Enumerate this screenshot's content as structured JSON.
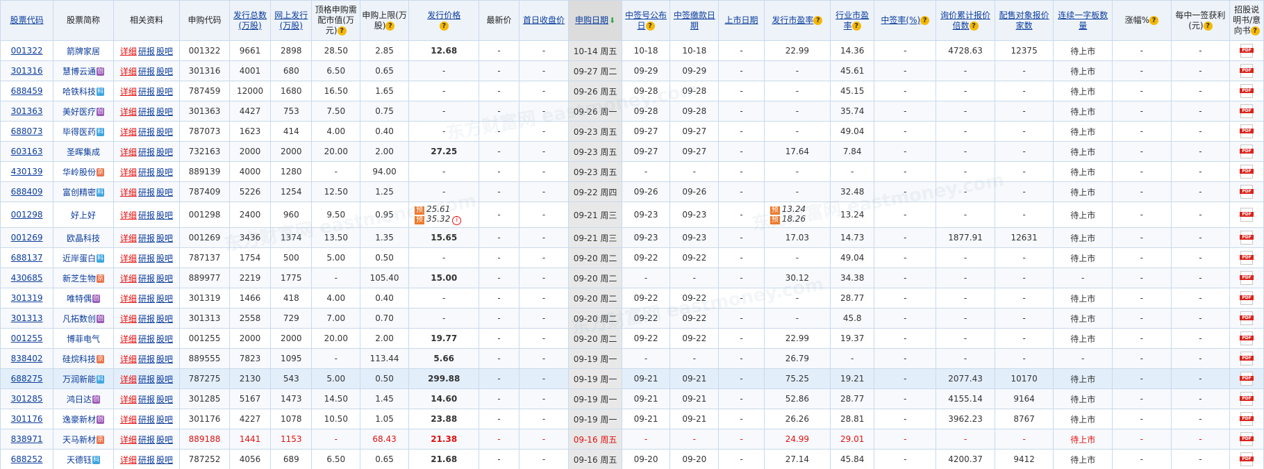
{
  "header": {
    "code": "股票代码",
    "name": "股票简称",
    "related": "相关资料",
    "apply_code": "申购代码",
    "total_issue": "发行总数(万股)",
    "online_issue": "网上发行(万股)",
    "top_market_value": "顶格申购需配市值(万元)",
    "apply_limit": "申购上限(万股)",
    "price": "发行价格",
    "latest_price": "最新价",
    "first_close": "首日收盘价",
    "apply_date": "申购日期",
    "lottery_date": "中签号公布日",
    "pay_date": "中签缴款日期",
    "listing_date": "上市日期",
    "issue_pe": "发行市盈率",
    "industry_pe": "行业市盈率",
    "win_rate": "中签率(%)",
    "inquiry_multiple": "询价累计报价倍数",
    "placement_count": "配售对象报价家数",
    "consecutive_limit": "连续一字板数量",
    "change_pct": "涨幅%",
    "profit_per_lot": "每中一签获利(元)",
    "prospectus": "招股说明书/意向书"
  },
  "related_links": {
    "detail": "详细",
    "research": "研报",
    "forum": "股吧"
  },
  "watermark": "东方财富网 eastmoney.com",
  "rows": [
    {
      "code": "001322",
      "name": "箭牌家居",
      "badge": "",
      "apply_code": "001322",
      "total": "9661",
      "online": "2898",
      "top": "28.50",
      "limit": "2.85",
      "price": "12.68",
      "latest": "-",
      "first": "-",
      "date": "10-14 周五",
      "lottery": "10-18",
      "pay": "10-18",
      "listing": "-",
      "ipe": "22.99",
      "ind_pe": "14.36",
      "rate": "-",
      "inquiry": "4728.63",
      "placement": "12375",
      "consec": "待上市",
      "chg": "-",
      "profit": "-"
    },
    {
      "code": "301316",
      "name": "慧博云通",
      "badge": "创",
      "apply_code": "301316",
      "total": "4001",
      "online": "680",
      "top": "6.50",
      "limit": "0.65",
      "price": "-",
      "latest": "-",
      "first": "-",
      "date": "09-27 周二",
      "lottery": "09-29",
      "pay": "09-29",
      "listing": "-",
      "ipe": "-",
      "ind_pe": "45.61",
      "rate": "-",
      "inquiry": "-",
      "placement": "-",
      "consec": "待上市",
      "chg": "-",
      "profit": "-"
    },
    {
      "code": "688459",
      "name": "哈铁科技",
      "badge": "科",
      "apply_code": "787459",
      "total": "12000",
      "online": "1680",
      "top": "16.50",
      "limit": "1.65",
      "price": "-",
      "latest": "-",
      "first": "-",
      "date": "09-26 周五",
      "lottery": "09-28",
      "pay": "09-28",
      "listing": "-",
      "ipe": "-",
      "ind_pe": "45.15",
      "rate": "-",
      "inquiry": "-",
      "placement": "-",
      "consec": "待上市",
      "chg": "-",
      "profit": "-"
    },
    {
      "code": "301363",
      "name": "美好医疗",
      "badge": "创",
      "apply_code": "301363",
      "total": "4427",
      "online": "753",
      "top": "7.50",
      "limit": "0.75",
      "price": "-",
      "latest": "-",
      "first": "-",
      "date": "09-26 周一",
      "lottery": "09-28",
      "pay": "09-28",
      "listing": "-",
      "ipe": "-",
      "ind_pe": "35.74",
      "rate": "-",
      "inquiry": "-",
      "placement": "-",
      "consec": "待上市",
      "chg": "-",
      "profit": "-"
    },
    {
      "code": "688073",
      "name": "毕得医药",
      "badge": "科",
      "apply_code": "787073",
      "total": "1623",
      "online": "414",
      "top": "4.00",
      "limit": "0.40",
      "price": "-",
      "latest": "-",
      "first": "-",
      "date": "09-23 周五",
      "lottery": "09-27",
      "pay": "09-27",
      "listing": "-",
      "ipe": "-",
      "ind_pe": "49.04",
      "rate": "-",
      "inquiry": "-",
      "placement": "-",
      "consec": "待上市",
      "chg": "-",
      "profit": "-"
    },
    {
      "code": "603163",
      "name": "圣晖集成",
      "badge": "",
      "apply_code": "732163",
      "total": "2000",
      "online": "2000",
      "top": "20.00",
      "limit": "2.00",
      "price": "27.25",
      "latest": "-",
      "first": "-",
      "date": "09-23 周五",
      "lottery": "09-27",
      "pay": "09-27",
      "listing": "-",
      "ipe": "17.64",
      "ind_pe": "7.84",
      "rate": "-",
      "inquiry": "-",
      "placement": "-",
      "consec": "待上市",
      "chg": "-",
      "profit": "-"
    },
    {
      "code": "430139",
      "name": "华岭股份",
      "badge": "京",
      "apply_code": "889139",
      "total": "4000",
      "online": "1280",
      "top": "-",
      "limit": "94.00",
      "price": "-",
      "latest": "-",
      "first": "-",
      "date": "09-23 周五",
      "lottery": "-",
      "pay": "-",
      "listing": "-",
      "ipe": "-",
      "ind_pe": "-",
      "rate": "-",
      "inquiry": "-",
      "placement": "-",
      "consec": "待上市",
      "chg": "-",
      "profit": "-"
    },
    {
      "code": "688409",
      "name": "富创精密",
      "badge": "科",
      "apply_code": "787409",
      "total": "5226",
      "online": "1254",
      "top": "12.50",
      "limit": "1.25",
      "price": "-",
      "latest": "-",
      "first": "-",
      "date": "09-22 周四",
      "lottery": "09-26",
      "pay": "09-26",
      "listing": "-",
      "ipe": "-",
      "ind_pe": "32.48",
      "rate": "-",
      "inquiry": "-",
      "placement": "-",
      "consec": "待上市",
      "chg": "-",
      "profit": "-"
    },
    {
      "code": "001298",
      "name": "好上好",
      "badge": "",
      "apply_code": "001298",
      "total": "2400",
      "online": "960",
      "top": "9.50",
      "limit": "0.95",
      "price": "",
      "latest": "-",
      "first": "-",
      "date": "09-21 周三",
      "lottery": "09-23",
      "pay": "09-23",
      "listing": "-",
      "ipe": "",
      "ind_pe": "13.24",
      "rate": "-",
      "inquiry": "-",
      "placement": "-",
      "consec": "待上市",
      "chg": "-",
      "profit": "-",
      "forecast_label": "预",
      "price_fc1": "25.61",
      "price_fc2": "35.32",
      "ipe_fc1": "13.24",
      "ipe_fc2": "18.26"
    },
    {
      "code": "001269",
      "name": "欧晶科技",
      "badge": "",
      "apply_code": "001269",
      "total": "3436",
      "online": "1374",
      "top": "13.50",
      "limit": "1.35",
      "price": "15.65",
      "latest": "-",
      "first": "-",
      "date": "09-21 周三",
      "lottery": "09-23",
      "pay": "09-23",
      "listing": "-",
      "ipe": "17.03",
      "ind_pe": "14.73",
      "rate": "-",
      "inquiry": "1877.91",
      "placement": "12631",
      "consec": "待上市",
      "chg": "-",
      "profit": "-"
    },
    {
      "code": "688137",
      "name": "近岸蛋白",
      "badge": "科",
      "apply_code": "787137",
      "total": "1754",
      "online": "500",
      "top": "5.00",
      "limit": "0.50",
      "price": "-",
      "latest": "-",
      "first": "-",
      "date": "09-20 周二",
      "lottery": "09-22",
      "pay": "09-22",
      "listing": "-",
      "ipe": "-",
      "ind_pe": "49.04",
      "rate": "-",
      "inquiry": "-",
      "placement": "-",
      "consec": "待上市",
      "chg": "-",
      "profit": "-"
    },
    {
      "code": "430685",
      "name": "新芝生物",
      "badge": "京",
      "apply_code": "889977",
      "total": "2219",
      "online": "1775",
      "top": "-",
      "limit": "105.40",
      "price": "15.00",
      "latest": "-",
      "first": "-",
      "date": "09-20 周二",
      "lottery": "-",
      "pay": "-",
      "listing": "-",
      "ipe": "30.12",
      "ind_pe": "34.38",
      "rate": "-",
      "inquiry": "-",
      "placement": "-",
      "consec": "-",
      "chg": "-",
      "profit": "-"
    },
    {
      "code": "301319",
      "name": "唯特偶",
      "badge": "创",
      "apply_code": "301319",
      "total": "1466",
      "online": "418",
      "top": "4.00",
      "limit": "0.40",
      "price": "-",
      "latest": "-",
      "first": "-",
      "date": "09-20 周二",
      "lottery": "09-22",
      "pay": "09-22",
      "listing": "-",
      "ipe": "-",
      "ind_pe": "28.77",
      "rate": "-",
      "inquiry": "-",
      "placement": "-",
      "consec": "待上市",
      "chg": "-",
      "profit": "-"
    },
    {
      "code": "301313",
      "name": "凡拓数创",
      "badge": "创",
      "apply_code": "301313",
      "total": "2558",
      "online": "729",
      "top": "7.00",
      "limit": "0.70",
      "price": "-",
      "latest": "-",
      "first": "-",
      "date": "09-20 周二",
      "lottery": "09-22",
      "pay": "09-22",
      "listing": "-",
      "ipe": "-",
      "ind_pe": "45.8",
      "rate": "-",
      "inquiry": "-",
      "placement": "-",
      "consec": "待上市",
      "chg": "-",
      "profit": "-"
    },
    {
      "code": "001255",
      "name": "博菲电气",
      "badge": "",
      "apply_code": "001255",
      "total": "2000",
      "online": "2000",
      "top": "20.00",
      "limit": "2.00",
      "price": "19.77",
      "latest": "-",
      "first": "-",
      "date": "09-20 周二",
      "lottery": "09-22",
      "pay": "09-22",
      "listing": "-",
      "ipe": "22.99",
      "ind_pe": "19.37",
      "rate": "-",
      "inquiry": "-",
      "placement": "-",
      "consec": "待上市",
      "chg": "-",
      "profit": "-"
    },
    {
      "code": "838402",
      "name": "硅烷科技",
      "badge": "京",
      "apply_code": "889555",
      "total": "7823",
      "online": "1095",
      "top": "-",
      "limit": "113.44",
      "price": "5.66",
      "latest": "-",
      "first": "-",
      "date": "09-19 周一",
      "lottery": "-",
      "pay": "-",
      "listing": "-",
      "ipe": "26.79",
      "ind_pe": "-",
      "rate": "-",
      "inquiry": "-",
      "placement": "-",
      "consec": "-",
      "chg": "-",
      "profit": "-"
    },
    {
      "code": "688275",
      "name": "万润新能",
      "badge": "科",
      "apply_code": "787275",
      "total": "2130",
      "online": "543",
      "top": "5.00",
      "limit": "0.50",
      "price": "299.88",
      "latest": "-",
      "first": "-",
      "date": "09-19 周一",
      "lottery": "09-21",
      "pay": "09-21",
      "listing": "-",
      "ipe": "75.25",
      "ind_pe": "19.21",
      "rate": "-",
      "inquiry": "2077.43",
      "placement": "10170",
      "consec": "待上市",
      "chg": "-",
      "profit": "-"
    },
    {
      "code": "301285",
      "name": "鸿日达",
      "badge": "创",
      "apply_code": "301285",
      "total": "5167",
      "online": "1473",
      "top": "14.50",
      "limit": "1.45",
      "price": "14.60",
      "latest": "-",
      "first": "-",
      "date": "09-19 周一",
      "lottery": "09-21",
      "pay": "09-21",
      "listing": "-",
      "ipe": "52.86",
      "ind_pe": "28.77",
      "rate": "-",
      "inquiry": "4155.14",
      "placement": "9164",
      "consec": "待上市",
      "chg": "-",
      "profit": "-"
    },
    {
      "code": "301176",
      "name": "逸豪新材",
      "badge": "创",
      "apply_code": "301176",
      "total": "4227",
      "online": "1078",
      "top": "10.50",
      "limit": "1.05",
      "price": "23.88",
      "latest": "-",
      "first": "-",
      "date": "09-19 周一",
      "lottery": "09-21",
      "pay": "09-21",
      "listing": "-",
      "ipe": "26.26",
      "ind_pe": "28.81",
      "rate": "-",
      "inquiry": "3962.23",
      "placement": "8767",
      "consec": "待上市",
      "chg": "-",
      "profit": "-"
    },
    {
      "code": "838971",
      "name": "天马新材",
      "badge": "京",
      "apply_code": "889188",
      "total": "1441",
      "online": "1153",
      "top": "-",
      "limit": "68.43",
      "price": "21.38",
      "latest": "-",
      "first": "-",
      "date": "09-16 周五",
      "lottery": "-",
      "pay": "-",
      "listing": "-",
      "ipe": "24.99",
      "ind_pe": "29.01",
      "rate": "-",
      "inquiry": "-",
      "placement": "-",
      "consec": "待上市",
      "chg": "-",
      "profit": "-"
    },
    {
      "code": "688252",
      "name": "天德钰",
      "badge": "科",
      "apply_code": "787252",
      "total": "4056",
      "online": "689",
      "top": "6.50",
      "limit": "0.65",
      "price": "21.68",
      "latest": "-",
      "first": "-",
      "date": "09-16 周五",
      "lottery": "09-20",
      "pay": "09-20",
      "listing": "-",
      "ipe": "27.14",
      "ind_pe": "45.84",
      "rate": "-",
      "inquiry": "4200.37",
      "placement": "9412",
      "consec": "待上市",
      "chg": "-",
      "profit": "-"
    }
  ],
  "colors": {
    "link": "#0b3c9c",
    "red": "#e4100e",
    "header_bg": "#eef3fa",
    "border": "#c9d9ec",
    "forecast": "#f07828"
  },
  "icons": {
    "question": "question-icon",
    "sort": "sort-down-icon",
    "pdf": "pdf-icon",
    "info": "info-icon"
  }
}
